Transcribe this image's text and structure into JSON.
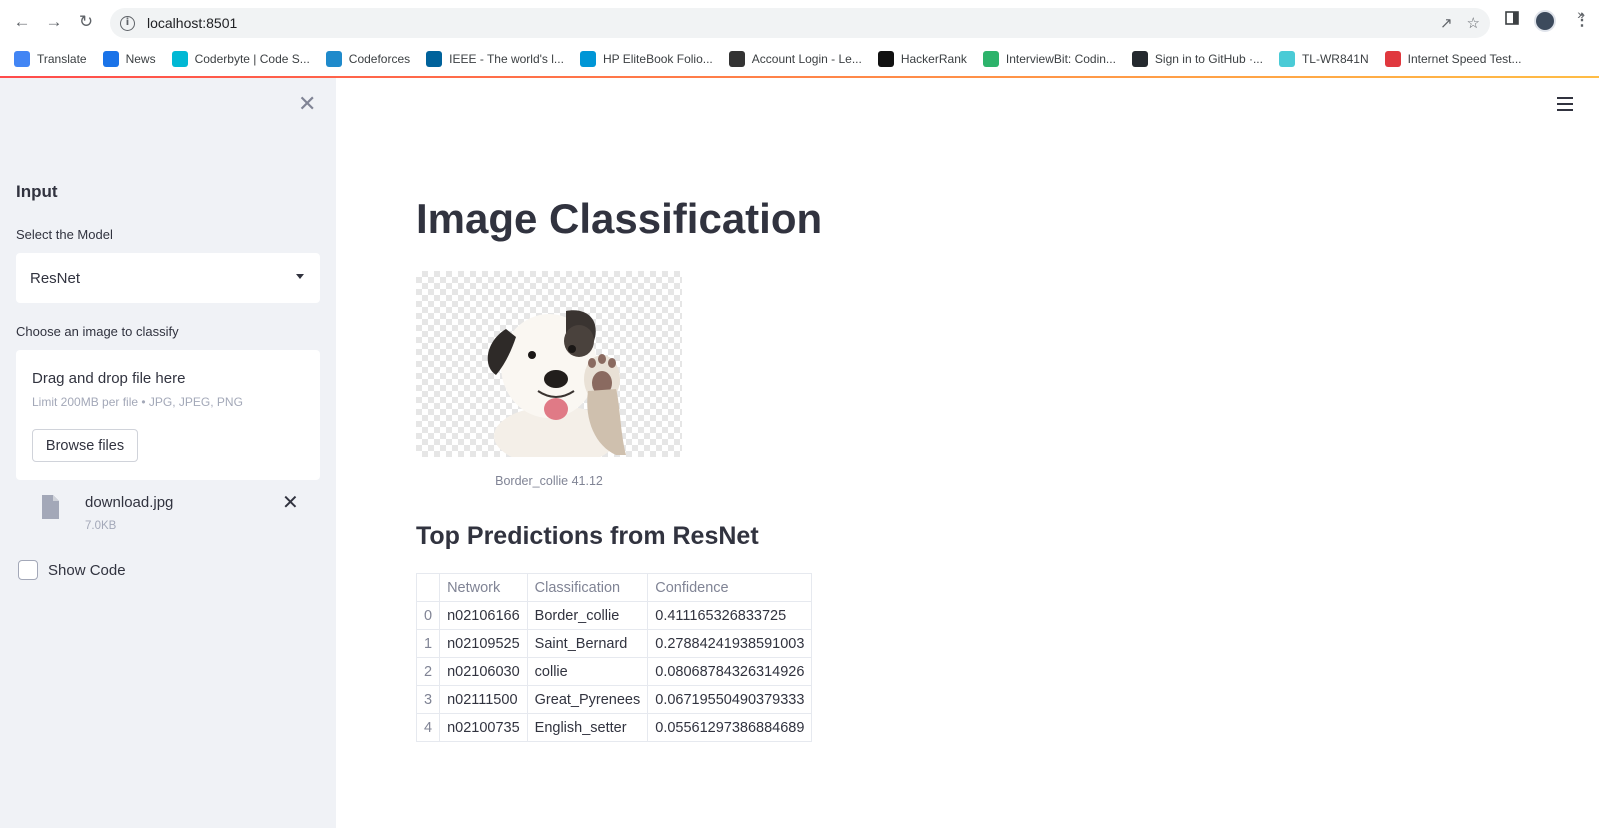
{
  "browser": {
    "url": "localhost:8501",
    "bookmarks": [
      {
        "label": "Translate",
        "icon": "google-translate-icon",
        "color": "#4285f4"
      },
      {
        "label": "News",
        "icon": "google-news-icon",
        "color": "#1a73e8"
      },
      {
        "label": "Coderbyte | Code S...",
        "icon": "coderbyte-icon",
        "color": "#00b8d4"
      },
      {
        "label": "Codeforces",
        "icon": "codeforces-icon",
        "color": "#1f8acb"
      },
      {
        "label": "IEEE - The world's l...",
        "icon": "ieee-icon",
        "color": "#00629b"
      },
      {
        "label": "HP EliteBook Folio...",
        "icon": "hp-icon",
        "color": "#0096d6"
      },
      {
        "label": "Account Login - Le...",
        "icon": "lenovo-icon",
        "color": "#333333"
      },
      {
        "label": "HackerRank",
        "icon": "hackerrank-icon",
        "color": "#111111"
      },
      {
        "label": "InterviewBit: Codin...",
        "icon": "interviewbit-icon",
        "color": "#2db36b"
      },
      {
        "label": "Sign in to GitHub ·...",
        "icon": "github-icon",
        "color": "#24292e"
      },
      {
        "label": "TL-WR841N",
        "icon": "tplink-icon",
        "color": "#4acbd6"
      },
      {
        "label": "Internet Speed Test...",
        "icon": "speedtest-icon",
        "color": "#e0383e"
      }
    ]
  },
  "sidebar": {
    "heading": "Input",
    "model_label": "Select the Model",
    "model_value": "ResNet",
    "upload_label": "Choose an image to classify",
    "drop_title": "Drag and drop file here",
    "drop_limit": "Limit 200MB per file • JPG, JPEG, PNG",
    "browse_label": "Browse files",
    "file_name": "download.jpg",
    "file_size": "7.0KB",
    "show_code_label": "Show Code"
  },
  "main": {
    "title": "Image Classification",
    "image_caption": "Border_collie 41.12",
    "section_title": "Top Predictions from ResNet",
    "table": {
      "headers": [
        "",
        "Network",
        "Classification",
        "Confidence"
      ],
      "rows": [
        [
          "0",
          "n02106166",
          "Border_collie",
          "0.411165326833725"
        ],
        [
          "1",
          "n02109525",
          "Saint_Bernard",
          "0.27884241938591003"
        ],
        [
          "2",
          "n02106030",
          "collie",
          "0.08068784326314926"
        ],
        [
          "3",
          "n02111500",
          "Great_Pyrenees",
          "0.06719550490379333"
        ],
        [
          "4",
          "n02100735",
          "English_setter",
          "0.05561297386884689"
        ]
      ]
    }
  },
  "colors": {
    "accent": "#ff4b4b",
    "sidebar_bg": "#f0f2f6",
    "text": "#31333f"
  }
}
